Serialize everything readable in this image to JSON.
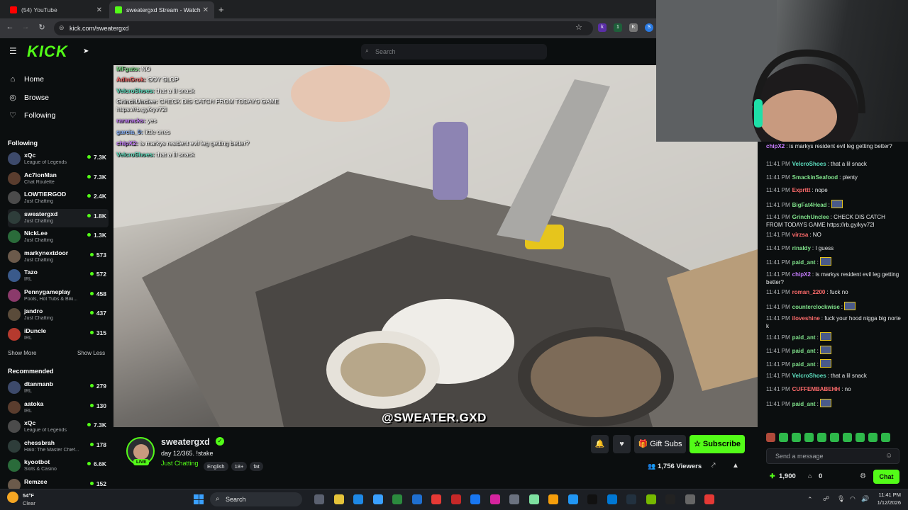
{
  "browser": {
    "tabs": [
      {
        "title": "(54) YouTube",
        "color": "#ff0000"
      },
      {
        "title": "sweatergxd Stream - Watch",
        "color": "#53fc18"
      }
    ],
    "url": "kick.com/sweatergxd"
  },
  "header": {
    "logo": "KICK",
    "search_placeholder": "Search"
  },
  "sidebar": {
    "nav": [
      {
        "label": "Home",
        "icon": "home-icon"
      },
      {
        "label": "Browse",
        "icon": "compass-icon"
      },
      {
        "label": "Following",
        "icon": "heart-icon"
      }
    ],
    "following_title": "Following",
    "following": [
      {
        "name": "xQc",
        "category": "League of Legends",
        "viewers": "7.3K"
      },
      {
        "name": "Ac7ionMan",
        "category": "Chat Roulette",
        "viewers": "7.3K"
      },
      {
        "name": "LOWTIERGOD",
        "category": "Just Chatting",
        "viewers": "2.4K"
      },
      {
        "name": "sweatergxd",
        "category": "Just Chatting",
        "viewers": "1.8K"
      },
      {
        "name": "NickLee",
        "category": "Just Chatting",
        "viewers": "1.3K"
      },
      {
        "name": "markynextdoor",
        "category": "Just Chatting",
        "viewers": "573"
      },
      {
        "name": "Tazo",
        "category": "IRL",
        "viewers": "572"
      },
      {
        "name": "Pennygameplay",
        "category": "Pools, Hot Tubs & Biki...",
        "viewers": "458"
      },
      {
        "name": "jandro",
        "category": "Just Chatting",
        "viewers": "437"
      },
      {
        "name": "iDuncle",
        "category": "IRL",
        "viewers": "315"
      }
    ],
    "show_more": "Show More",
    "show_less": "Show Less",
    "recommended_title": "Recommended",
    "recommended": [
      {
        "name": "dtanmanb",
        "category": "IRL",
        "viewers": "279"
      },
      {
        "name": "aatoka",
        "category": "IRL",
        "viewers": "130"
      },
      {
        "name": "xQc",
        "category": "League of Legends",
        "viewers": "7.3K"
      },
      {
        "name": "chessbrah",
        "category": "Halo: The Master Chief...",
        "viewers": "178"
      },
      {
        "name": "kyootbot",
        "category": "Slots & Casino",
        "viewers": "6.6K"
      },
      {
        "name": "Remzee",
        "category": "",
        "viewers": "152"
      }
    ]
  },
  "overlay_chat": [
    {
      "user": "MFgato:",
      "msg": "NO",
      "color": "#7fe08a"
    },
    {
      "user": "AdinGrok:",
      "msg": "GOY SLOP",
      "color": "#ff6b6b"
    },
    {
      "user": "VelcroShoes:",
      "msg": "that a lil snack",
      "color": "#5ee0c0"
    },
    {
      "user": "GrinchUnclee:",
      "msg": "CHECK DIS CATCH FROM TODAYS GAME",
      "color": "#e7e9ea"
    },
    {
      "user": "",
      "msg": "https://rb.gy/kyv72l",
      "color": "#e7e9ea"
    },
    {
      "user": "rararacks:",
      "msg": "yes",
      "color": "#c77dff"
    },
    {
      "user": "garcia_0:",
      "msg": "little ones",
      "color": "#8fb8ff"
    },
    {
      "user": "chipX2:",
      "msg": "is markys resident evil leg getting better?",
      "color": "#c77dff"
    },
    {
      "user": "VelcroShoes:",
      "msg": "that a lil snack",
      "color": "#5ee0c0"
    }
  ],
  "watermark": "@SWEATER.GXD",
  "streamer": {
    "name": "sweatergxd",
    "title": "day 12/365. !stake",
    "category": "Just Chatting",
    "tags": [
      "English",
      "18+",
      "fat"
    ],
    "live_label": "LIVE",
    "viewers": "1,756",
    "viewers_label": "Viewers"
  },
  "buttons": {
    "gift": "Gift Subs",
    "subscribe": "Subscribe"
  },
  "chat": {
    "messages": [
      {
        "time": "",
        "user": "chipX2",
        "msg": "is markys resident evil leg getting better?",
        "color": "#c77dff"
      },
      {
        "time": "11:41 PM",
        "user": "VelcroShoes",
        "msg": "that a lil snack",
        "color": "#5ee0c0"
      },
      {
        "time": "11:41 PM",
        "user": "SmackinSeafood",
        "msg": "plenty",
        "color": "#7fe08a"
      },
      {
        "time": "11:41 PM",
        "user": "Exprttt",
        "msg": "nope",
        "color": "#ff6b6b"
      },
      {
        "time": "11:41 PM",
        "user": "BigFat4Head",
        "msg": "",
        "color": "#7fe08a"
      },
      {
        "time": "11:41 PM",
        "user": "GrinchUnclee",
        "msg": "CHECK DIS CATCH FROM TODAYS GAME https://rb.gy/kyv72l",
        "color": "#7fe08a"
      },
      {
        "time": "11:41 PM",
        "user": "virzsa",
        "msg": "NO",
        "color": "#ff6b6b"
      },
      {
        "time": "11:41 PM",
        "user": "rinaldy",
        "msg": "I guess",
        "color": "#7fe08a"
      },
      {
        "time": "11:41 PM",
        "user": "paid_ant",
        "msg": "",
        "color": "#7fe08a"
      },
      {
        "time": "11:41 PM",
        "user": "chipX2",
        "msg": "is markys resident evil leg getting better?",
        "color": "#c77dff"
      },
      {
        "time": "11:41 PM",
        "user": "roman_2200",
        "msg": "fuck no",
        "color": "#ff6b6b"
      },
      {
        "time": "11:41 PM",
        "user": "counterclockwise",
        "msg": "",
        "color": "#7fe08a"
      },
      {
        "time": "11:41 PM",
        "user": "iloveshine",
        "msg": "fuck your hood nigga big norte k",
        "color": "#ff6b6b"
      },
      {
        "time": "11:41 PM",
        "user": "paid_ant",
        "msg": "",
        "color": "#7fe08a"
      },
      {
        "time": "11:41 PM",
        "user": "paid_ant",
        "msg": "",
        "color": "#7fe08a"
      },
      {
        "time": "11:41 PM",
        "user": "paid_ant",
        "msg": "",
        "color": "#7fe08a"
      },
      {
        "time": "11:41 PM",
        "user": "VelcroShoes",
        "msg": "that a lil snack",
        "color": "#5ee0c0"
      },
      {
        "time": "11:41 PM",
        "user": "CUFFEMBABEHH",
        "msg": "no",
        "color": "#ff6b6b"
      },
      {
        "time": "11:41 PM",
        "user": "paid_ant",
        "msg": "",
        "color": "#7fe08a"
      }
    ],
    "input_placeholder": "Send a message",
    "points": "1,900",
    "other_count": "0",
    "chat_button": "Chat"
  },
  "taskbar": {
    "weather_temp": "54°F",
    "weather_desc": "Clear",
    "search": "Search",
    "time": "11:41 PM",
    "date": "1/12/2026"
  }
}
